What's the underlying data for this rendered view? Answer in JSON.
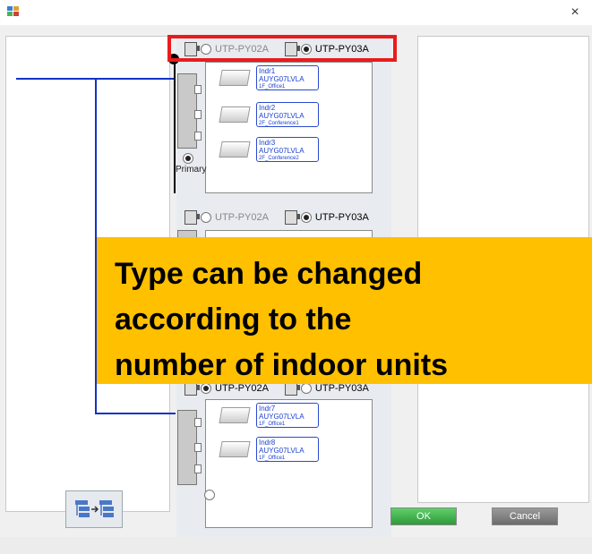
{
  "window": {
    "close_glyph": "×",
    "app_icon": "app-icon"
  },
  "group1": {
    "option_a": "UTP-PY02A",
    "option_b": "UTP-PY03A",
    "selected": "UTP-PY03A",
    "indoor_units": [
      {
        "name": "Indr1",
        "model": "AUYG07LVLA",
        "location": "1F_Office1"
      },
      {
        "name": "Indr2",
        "model": "AUYG07LVLA",
        "location": "2F_Conference1"
      },
      {
        "name": "Indr3",
        "model": "AUYG07LVLA",
        "location": "2F_Conference2"
      }
    ],
    "primary_label": "Primary"
  },
  "group2": {
    "option_a": "UTP-PY02A",
    "option_b": "UTP-PY03A",
    "selected": "UTP-PY03A"
  },
  "group3": {
    "option_a": "UTP-PY02A",
    "option_b": "UTP-PY03A",
    "selected": "UTP-PY02A",
    "indoor_units": [
      {
        "name": "Indr7",
        "model": "AUYG07LVLA",
        "location": "1F_Office1"
      },
      {
        "name": "Indr8",
        "model": "AUYG07LVLA",
        "location": "1F_Office1"
      }
    ]
  },
  "buttons": {
    "ok": "OK",
    "cancel": "Cancel"
  },
  "callout": {
    "text": "Type can be changed\naccording to the\nnumber of indoor units"
  },
  "colors": {
    "callout": "#ffc000",
    "highlight": "#e81c1c",
    "pipe": "#1432c8",
    "ok": "#3aa647"
  }
}
